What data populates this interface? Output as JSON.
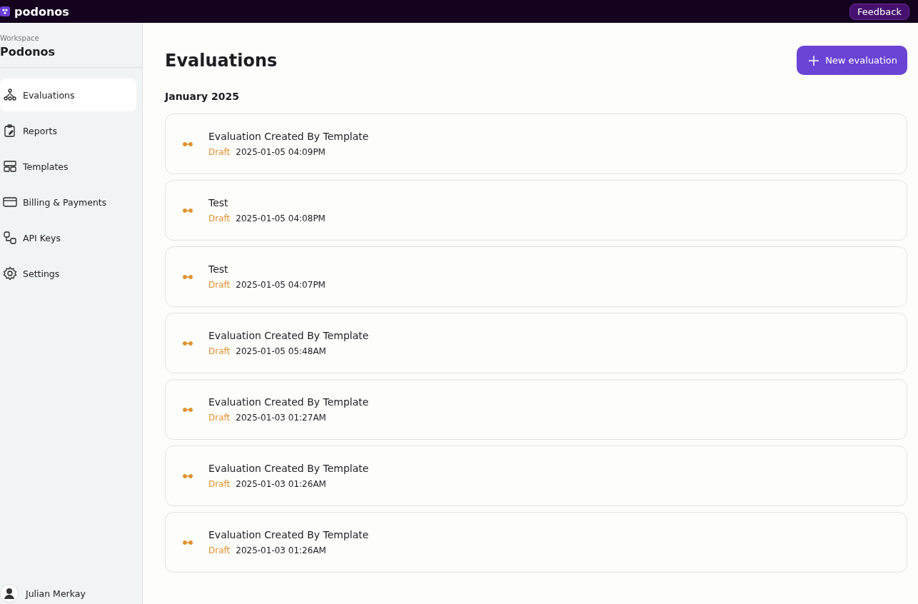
{
  "topbar": {
    "logo": "podonos",
    "feedback": "Feedback"
  },
  "sidebar": {
    "workspace_label": "Workspace",
    "workspace": "Podonos",
    "items": [
      {
        "label": "Evaluations",
        "kind": "nodes",
        "selected": true
      },
      {
        "label": "Reports",
        "kind": "clipboard",
        "selected": false
      },
      {
        "label": "Templates",
        "kind": "layout",
        "selected": false
      },
      {
        "label": "Billing & Payments",
        "kind": "card",
        "selected": false
      },
      {
        "label": "API Keys",
        "kind": "keys",
        "selected": false
      },
      {
        "label": "Settings",
        "kind": "gear",
        "selected": false
      }
    ],
    "user": "Julian Merkay"
  },
  "page": {
    "title": "Evaluations",
    "new_button": "New evaluation",
    "group": "January 2025",
    "evaluations": [
      {
        "title": "Evaluation Created By Template",
        "status": "Draft",
        "kind": "draft",
        "date": "2025-01-05 04:09PM"
      },
      {
        "title": "Test",
        "status": "Draft",
        "kind": "draft",
        "date": "2025-01-05 04:08PM"
      },
      {
        "title": "Test",
        "status": "Draft",
        "kind": "draft",
        "date": "2025-01-05 04:07PM"
      },
      {
        "title": "Evaluation Created By Template",
        "status": "Draft",
        "kind": "draft",
        "date": "2025-01-05 05:48AM"
      },
      {
        "title": "Evaluation Created By Template",
        "status": "Draft",
        "kind": "draft",
        "date": "2025-01-03 01:27AM"
      },
      {
        "title": "Evaluation Created By Template",
        "status": "Draft",
        "kind": "draft",
        "date": "2025-01-03 01:26AM"
      },
      {
        "title": "Evaluation Created By Template",
        "status": "Draft",
        "kind": "draft",
        "date": "2025-01-03 01:26AM"
      }
    ]
  }
}
